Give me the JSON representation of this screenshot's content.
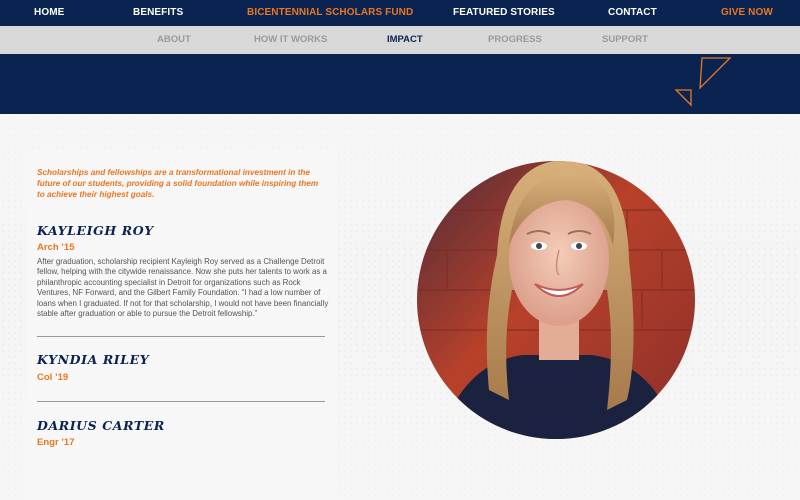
{
  "top_nav": {
    "home": "HOME",
    "benefits": "BENEFITS",
    "fund": "BICENTENNIAL SCHOLARS FUND",
    "featured": "FEATURED STORIES",
    "contact": "CONTACT",
    "give": "GIVE NOW"
  },
  "sub_nav": {
    "about": "ABOUT",
    "how": "HOW IT WORKS",
    "impact": "IMPACT",
    "progress": "PROGRESS",
    "support": "SUPPORT"
  },
  "content": {
    "intro": "Scholarships and fellowships are a transformational investment in the future of our students, providing a solid foundation while inspiring them to achieve their highest goals.",
    "people": [
      {
        "name": "KAYLEIGH ROY",
        "year": "Arch ’15",
        "bio": "After graduation, scholarship recipient Kayleigh Roy served as a Challenge Detroit fellow, helping with the citywide renaissance. Now she puts her talents to work as a philanthropic accounting specialist in Detroit for organizations such as Rock Ventures, NF Forward, and the Gilbert Family Foundation. “I had a low number of loans when I graduated. If not for that scholarship, I would not have been financially stable after graduation or able to pursue the Detroit fellowship.”"
      },
      {
        "name": "KYNDIA RILEY",
        "year": "Col ’19"
      },
      {
        "name": "DARIUS CARTER",
        "year": "Engr ’17"
      }
    ]
  },
  "colors": {
    "navy": "#0a2350",
    "orange": "#e87722",
    "subnav_bg": "#d9d9d9"
  },
  "icons": {
    "banner_decoration": "triangle-outline-icons",
    "portrait": "portrait-photo"
  }
}
